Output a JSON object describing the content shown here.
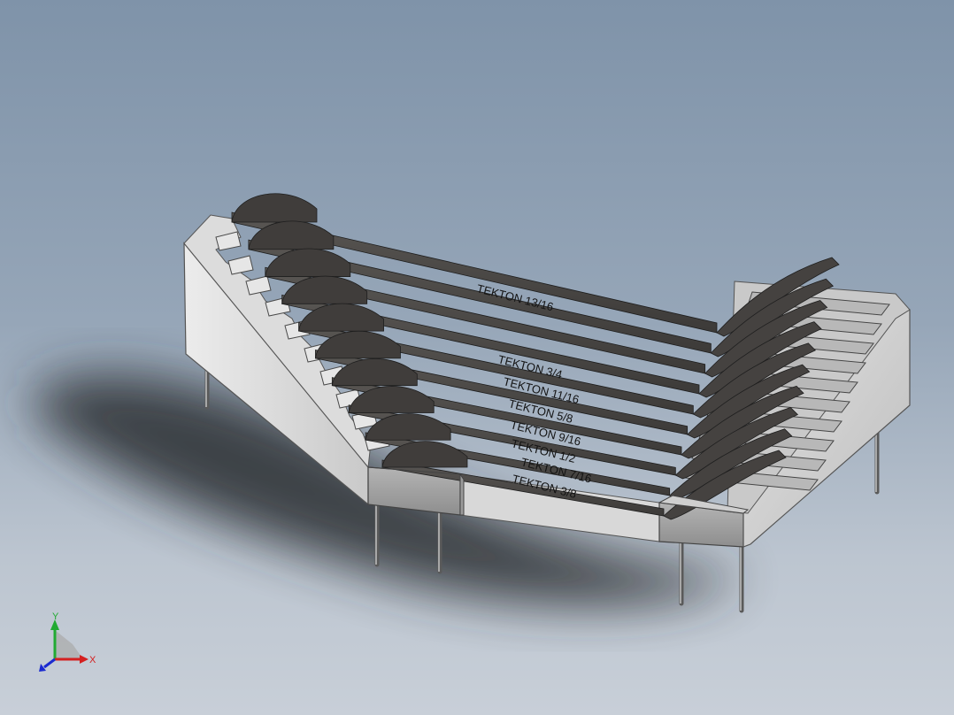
{
  "viewport": {
    "background_top": "#7f93a9",
    "background_bottom": "#c8cfd8"
  },
  "model": {
    "body_color": "#d4d4d4",
    "wrench_color": "#4a4744",
    "wrench_labels": [
      "TEKTON 13/16",
      "TEKTON 3/4",
      "TEKTON 11/16",
      "TEKTON 5/8",
      "TEKTON 9/16",
      "TEKTON 1/2",
      "TEKTON 7/16",
      "TEKTON 3/8"
    ]
  },
  "triad": {
    "x_label": "X",
    "y_label": "Y",
    "x_color": "#d42020",
    "y_color": "#22aa33",
    "z_color": "#1a2ad0"
  }
}
